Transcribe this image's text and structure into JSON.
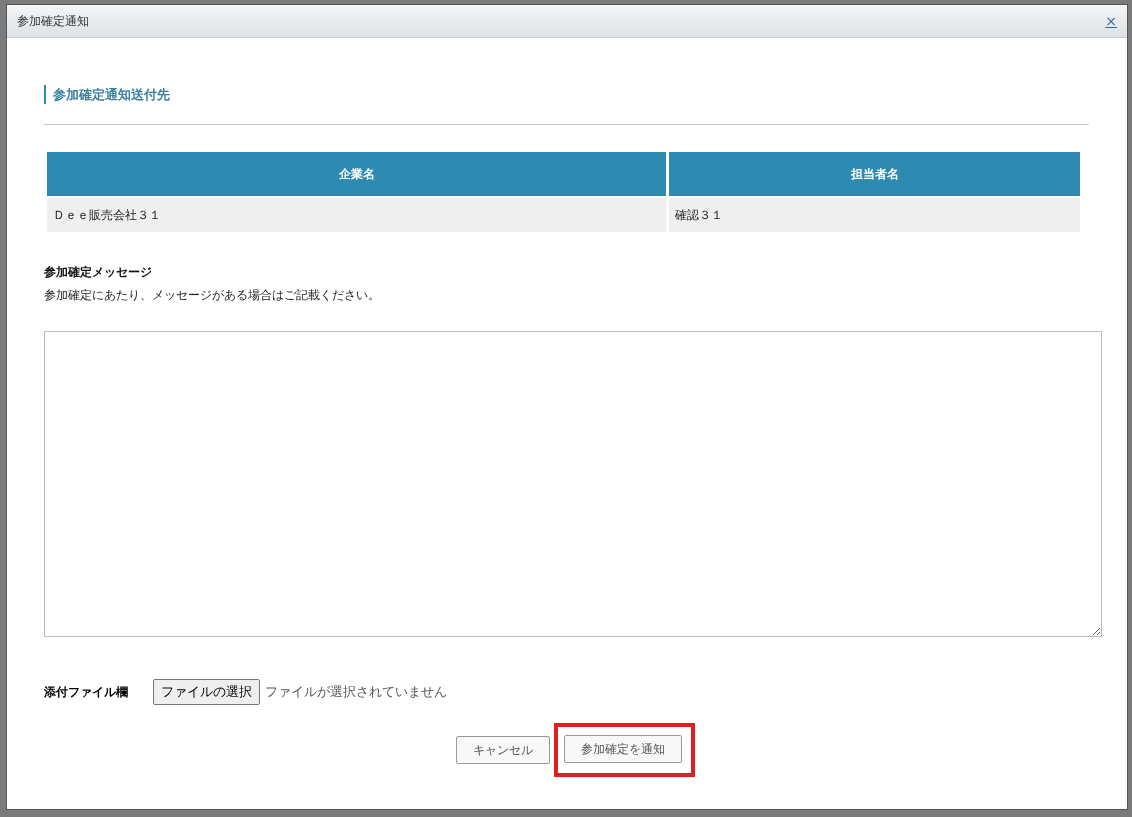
{
  "dialog": {
    "title": "参加確定通知",
    "close": "×"
  },
  "section": {
    "heading": "参加確定通知送付先"
  },
  "table": {
    "columns": [
      "企業名",
      "担当者名"
    ],
    "rows": [
      [
        "Ｄｅｅ販売会社３１",
        "確認３１"
      ]
    ]
  },
  "message": {
    "label": "参加確定メッセージ",
    "hint": "参加確定にあたり、メッセージがある場合はご記載ください。"
  },
  "attachment": {
    "label": "添付ファイル欄",
    "button": "ファイルの選択",
    "status": "ファイルが選択されていません"
  },
  "buttons": [
    {
      "label": "キャンセル",
      "highlighted": false
    },
    {
      "label": "参加確定を通知",
      "highlighted": true
    }
  ]
}
